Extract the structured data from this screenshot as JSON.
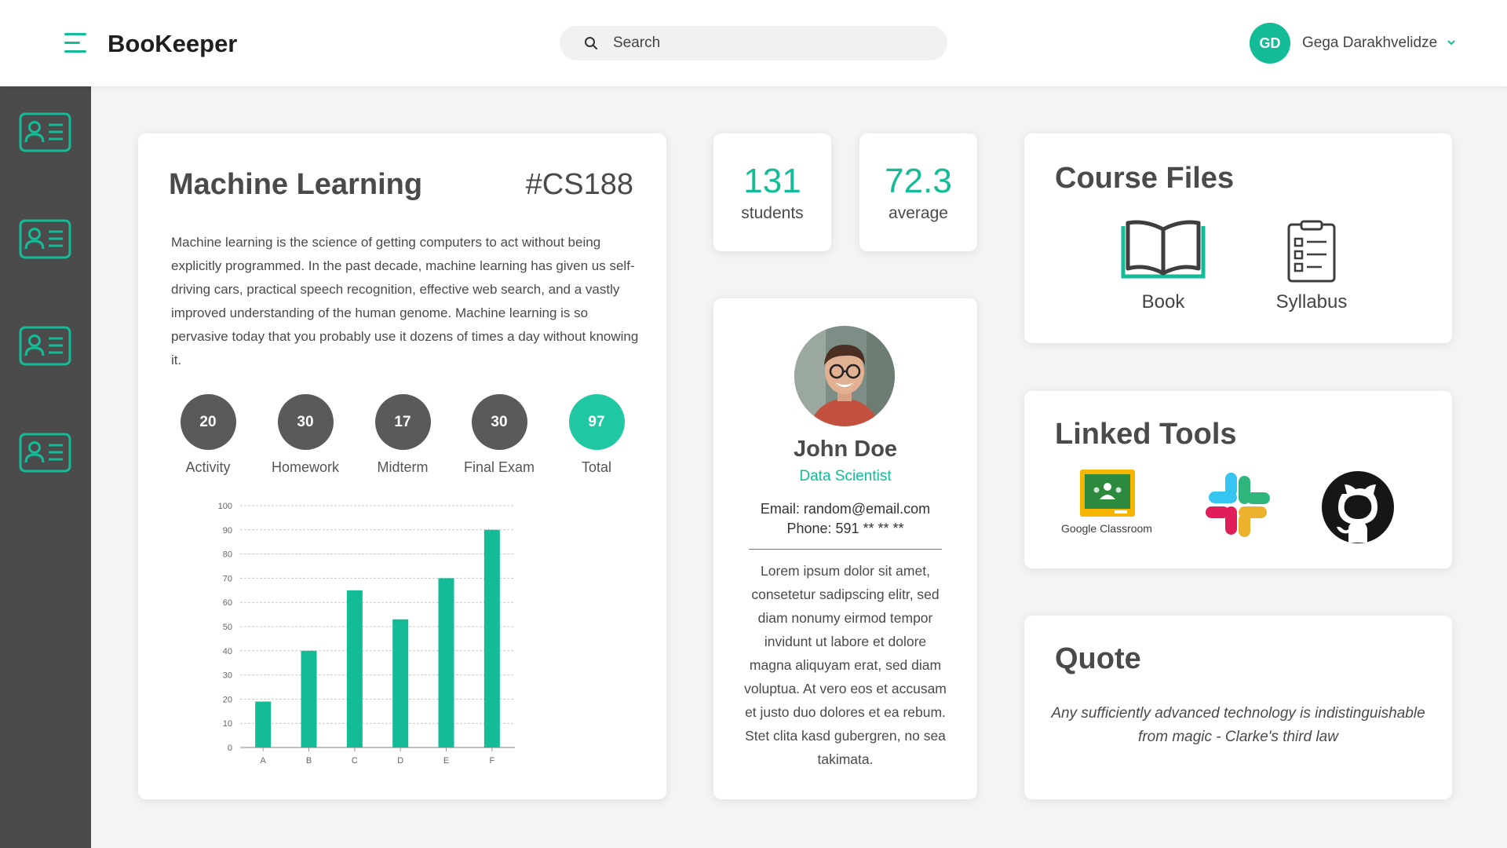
{
  "app": {
    "title": "BooKeeper"
  },
  "search": {
    "placeholder": "Search"
  },
  "user": {
    "initials": "GD",
    "name": "Gega Darakhvelidze"
  },
  "sidebar": {
    "items": [
      {
        "icon": "id-card-icon"
      },
      {
        "icon": "id-card-icon"
      },
      {
        "icon": "id-card-icon"
      },
      {
        "icon": "id-card-icon"
      }
    ]
  },
  "course": {
    "title": "Machine Learning",
    "code": "#CS188",
    "description": "Machine learning is the science of getting computers to act without being explicitly programmed. In the past decade, machine learning has given us self-driving cars, practical speech recognition, effective web search, and a vastly improved understanding of the human genome. Machine learning is so pervasive today that you probably use it dozens of times a day without knowing it.",
    "scores": [
      {
        "value": "20",
        "label": "Activity"
      },
      {
        "value": "30",
        "label": "Homework"
      },
      {
        "value": "17",
        "label": "Midterm"
      },
      {
        "value": "30",
        "label": "Final Exam"
      },
      {
        "value": "97",
        "label": "Total"
      }
    ]
  },
  "stats": {
    "students": {
      "value": "131",
      "label": "students"
    },
    "average": {
      "value": "72.3",
      "label": "average"
    }
  },
  "profile": {
    "name": "John Doe",
    "role": "Data Scientist",
    "email": "Email: random@email.com",
    "phone": "Phone: 591 ** ** **",
    "bio": "Lorem ipsum dolor sit amet, consetetur sadipscing elitr, sed diam nonumy eirmod tempor invidunt ut labore et dolore magna aliquyam erat, sed diam voluptua. At vero eos et accusam et justo duo dolores et ea rebum. Stet clita kasd gubergren, no sea takimata."
  },
  "course_files": {
    "title": "Course Files",
    "items": [
      {
        "label": "Book",
        "icon": "open-book-icon"
      },
      {
        "label": "Syllabus",
        "icon": "clipboard-list-icon"
      }
    ]
  },
  "linked_tools": {
    "title": "Linked Tools",
    "items": [
      {
        "label": "Google Classroom",
        "icon": "google-classroom-icon"
      },
      {
        "label": "",
        "icon": "slack-icon"
      },
      {
        "label": "",
        "icon": "github-icon"
      }
    ]
  },
  "quote": {
    "title": "Quote",
    "text": "Any sufficiently advanced technology is indistinguishable from magic - Clarke's third law"
  },
  "colors": {
    "accent": "#13bc97",
    "sidebar": "#4b4b4b",
    "score_circle": "#5a5a5a",
    "total_circle": "#1fc8a3",
    "bar": "#13bc97"
  },
  "chart_data": {
    "type": "bar",
    "categories": [
      "A",
      "B",
      "C",
      "D",
      "E",
      "F"
    ],
    "values": [
      19,
      40,
      65,
      53,
      70,
      90
    ],
    "yticks": [
      0,
      10,
      20,
      30,
      40,
      50,
      60,
      70,
      80,
      90,
      100
    ],
    "ylim": [
      0,
      100
    ],
    "grid": true,
    "title": "",
    "xlabel": "",
    "ylabel": ""
  }
}
